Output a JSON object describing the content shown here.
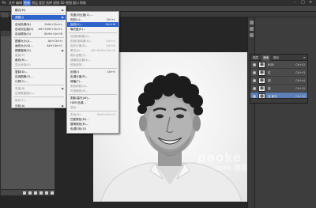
{
  "menubar": {
    "items": [
      "Ps",
      "文件",
      "编辑",
      "图像",
      "图层",
      "类型",
      "选择",
      "滤镜",
      "3D",
      "视图",
      "窗口",
      "帮助"
    ]
  },
  "document": {
    "tab_title": ""
  },
  "image_menu": {
    "items": [
      {
        "label": "模式(M)",
        "shortcut": "",
        "submenu": true,
        "state": "normal"
      },
      {
        "label": "调整(J)",
        "shortcut": "",
        "submenu": true,
        "state": "highlight"
      },
      {
        "label": "自动色调(N)",
        "shortcut": "Shift+Ctrl+L",
        "submenu": false,
        "state": "normal"
      },
      {
        "label": "自动对比度(U)",
        "shortcut": "Alt+Shift+Ctrl+L",
        "submenu": false,
        "state": "normal"
      },
      {
        "label": "自动颜色(O)",
        "shortcut": "Shift+Ctrl+B",
        "submenu": false,
        "state": "normal"
      },
      {
        "label": "图像大小(I)...",
        "shortcut": "Alt+Ctrl+I",
        "submenu": false,
        "state": "normal"
      },
      {
        "label": "画布大小(S)...",
        "shortcut": "Alt+Ctrl+C",
        "submenu": false,
        "state": "normal"
      },
      {
        "label": "图像旋转(G)",
        "shortcut": "",
        "submenu": true,
        "state": "normal"
      },
      {
        "label": "裁剪(P)",
        "shortcut": "",
        "submenu": false,
        "state": "disabled"
      },
      {
        "label": "裁切(R)...",
        "shortcut": "",
        "submenu": false,
        "state": "normal"
      },
      {
        "label": "显示全部(V)",
        "shortcut": "",
        "submenu": false,
        "state": "disabled"
      },
      {
        "label": "复制(D)...",
        "shortcut": "",
        "submenu": false,
        "state": "normal"
      },
      {
        "label": "应用图像(Y)...",
        "shortcut": "",
        "submenu": false,
        "state": "normal"
      },
      {
        "label": "计算(C)...",
        "shortcut": "",
        "submenu": false,
        "state": "normal"
      },
      {
        "label": "变量(B)",
        "shortcut": "",
        "submenu": true,
        "state": "disabled"
      },
      {
        "label": "应用数据组(L)...",
        "shortcut": "",
        "submenu": false,
        "state": "disabled"
      },
      {
        "label": "陷印(T)...",
        "shortcut": "",
        "submenu": false,
        "state": "disabled"
      },
      {
        "label": "分析(A)",
        "shortcut": "",
        "submenu": true,
        "state": "normal"
      }
    ]
  },
  "adjust_menu": {
    "items": [
      {
        "label": "亮度/对比度(C)...",
        "shortcut": "",
        "state": "normal"
      },
      {
        "label": "色阶(L)...",
        "shortcut": "Ctrl+L",
        "state": "normal"
      },
      {
        "label": "曲线(U)...",
        "shortcut": "Ctrl+M",
        "state": "highlight"
      },
      {
        "label": "曝光度(E)...",
        "shortcut": "",
        "state": "normal"
      },
      {
        "label": "自然饱和度(V)...",
        "shortcut": "",
        "state": "disabled"
      },
      {
        "label": "色相/饱和度(H)...",
        "shortcut": "Ctrl+U",
        "state": "disabled"
      },
      {
        "label": "色彩平衡(B)...",
        "shortcut": "Ctrl+B",
        "state": "disabled"
      },
      {
        "label": "黑白(K)...",
        "shortcut": "Alt+Shift+Ctrl+B",
        "state": "disabled"
      },
      {
        "label": "照片滤镜(F)...",
        "shortcut": "",
        "state": "disabled"
      },
      {
        "label": "通道混合器(X)...",
        "shortcut": "",
        "state": "disabled"
      },
      {
        "label": "颜色查找...",
        "shortcut": "",
        "state": "disabled"
      },
      {
        "label": "反相(I)",
        "shortcut": "Ctrl+I",
        "state": "normal"
      },
      {
        "label": "色调分离(P)...",
        "shortcut": "",
        "state": "normal"
      },
      {
        "label": "阈值(T)...",
        "shortcut": "",
        "state": "normal"
      },
      {
        "label": "渐变映射(G)...",
        "shortcut": "",
        "state": "disabled"
      },
      {
        "label": "可选颜色(S)...",
        "shortcut": "",
        "state": "disabled"
      },
      {
        "label": "阴影/高光(W)...",
        "shortcut": "",
        "state": "normal"
      },
      {
        "label": "HDR 色调...",
        "shortcut": "",
        "state": "normal"
      },
      {
        "label": "变化...",
        "shortcut": "",
        "state": "disabled"
      },
      {
        "label": "去色(D)",
        "shortcut": "Shift+Ctrl+U",
        "state": "disabled"
      },
      {
        "label": "匹配颜色(M)...",
        "shortcut": "",
        "state": "normal"
      },
      {
        "label": "替换颜色(R)...",
        "shortcut": "",
        "state": "normal"
      },
      {
        "label": "色调均化(Q)",
        "shortcut": "",
        "state": "normal"
      }
    ]
  },
  "channels_panel": {
    "tabs": [
      "图层",
      "通道",
      "路径"
    ],
    "rows": [
      {
        "name": "RGB",
        "shortcut": "Ctrl+2",
        "selected": false
      },
      {
        "name": "红",
        "shortcut": "Ctrl+3",
        "selected": false
      },
      {
        "name": "绿",
        "shortcut": "Ctrl+4",
        "selected": false
      },
      {
        "name": "蓝",
        "shortcut": "Ctrl+5",
        "selected": false
      },
      {
        "name": "蓝 副本",
        "shortcut": "Ctrl+6",
        "selected": true
      }
    ]
  },
  "watermark": {
    "line1": "paoke",
    "line2": ".com 泡客"
  },
  "colors": {
    "highlight": "#2f63c9",
    "menu_bg": "#f2f2f2",
    "selected_channel": "#5c7fb8"
  }
}
